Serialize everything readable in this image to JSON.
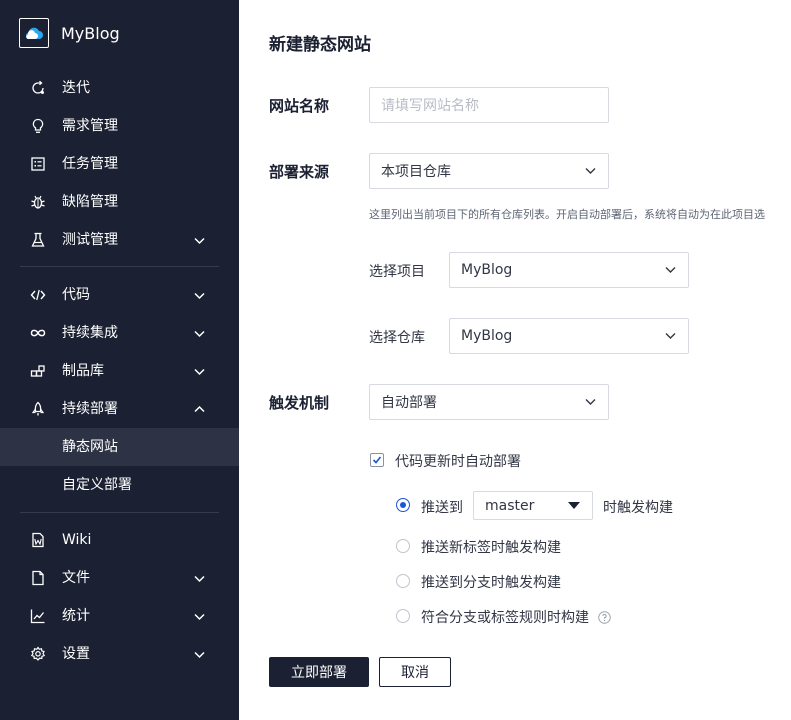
{
  "app": {
    "name": "MyBlog"
  },
  "sidebar": {
    "items": [
      {
        "label": "迭代",
        "icon": "iteration-icon"
      },
      {
        "label": "需求管理",
        "icon": "lightbulb-icon"
      },
      {
        "label": "任务管理",
        "icon": "task-list-icon"
      },
      {
        "label": "缺陷管理",
        "icon": "bug-icon"
      },
      {
        "label": "测试管理",
        "icon": "flask-icon"
      },
      {
        "label": "代码",
        "icon": "code-icon"
      },
      {
        "label": "持续集成",
        "icon": "infinity-icon"
      },
      {
        "label": "制品库",
        "icon": "package-icon"
      },
      {
        "label": "持续部署",
        "icon": "rocket-icon"
      },
      {
        "label": "静态网站"
      },
      {
        "label": "自定义部署"
      },
      {
        "label": "Wiki",
        "icon": "wiki-icon"
      },
      {
        "label": "文件",
        "icon": "file-icon"
      },
      {
        "label": "统计",
        "icon": "chart-icon"
      },
      {
        "label": "设置",
        "icon": "gear-icon"
      }
    ]
  },
  "form": {
    "title": "新建静态网站",
    "site_name_label": "网站名称",
    "site_name_placeholder": "请填写网站名称",
    "source_label": "部署来源",
    "source_value": "本项目仓库",
    "source_hint": "这里列出当前项目下的所有仓库列表。开启自动部署后，系统将自动为在此项目选",
    "project_label": "选择项目",
    "project_value": "MyBlog",
    "repo_label": "选择仓库",
    "repo_value": "MyBlog",
    "trigger_label": "触发机制",
    "trigger_value": "自动部署",
    "auto_checkbox_label": "代码更新时自动部署",
    "auto_checkbox_checked": true,
    "radio_push_prefix": "推送到",
    "branch_value": "master",
    "radio_push_suffix": "时触发构建",
    "radio_tag": "推送新标签时触发构建",
    "radio_branch": "推送到分支时触发构建",
    "radio_rule": "符合分支或标签规则时构建",
    "selected_radio": "push"
  },
  "buttons": {
    "deploy": "立即部署",
    "cancel": "取消"
  },
  "colors": {
    "sidebar_bg": "#1b2132",
    "active_item_bg": "#2d3344",
    "primary": "#1b2132",
    "radio_accent": "#1a56db"
  }
}
